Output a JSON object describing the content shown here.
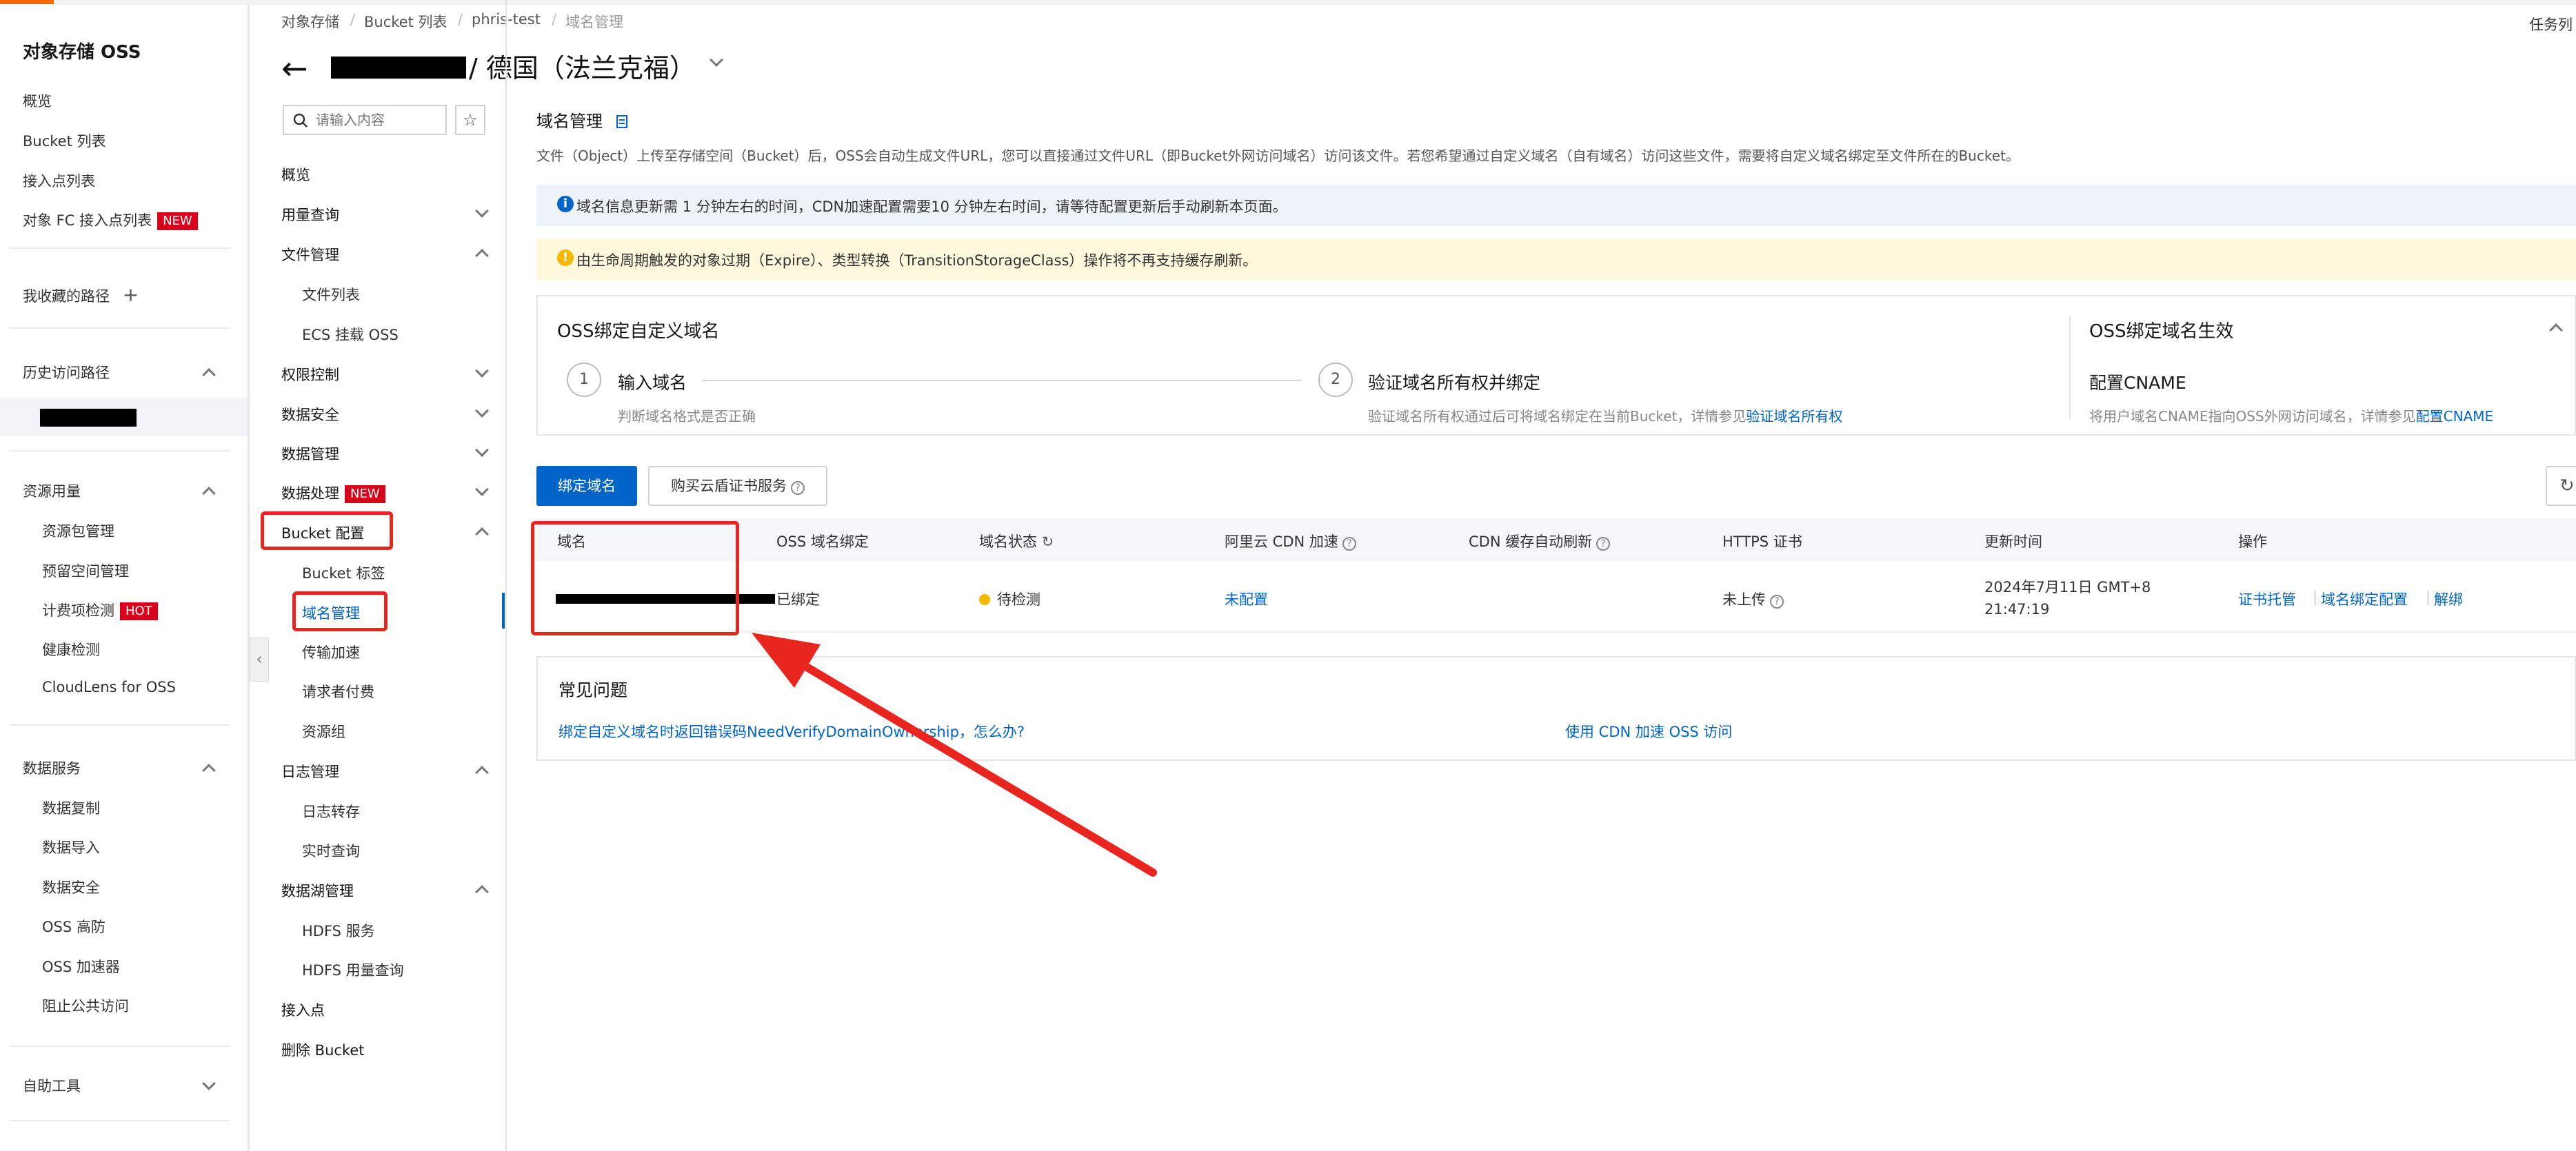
{
  "topbar": {
    "accent_color": "#ff6a00",
    "right_label": "任务列"
  },
  "left_nav": {
    "title": "对象存储 OSS",
    "items": [
      {
        "label": "概览"
      },
      {
        "label": "Bucket 列表"
      },
      {
        "label": "接入点列表"
      },
      {
        "label": "对象 FC 接入点列表",
        "badge": "NEW"
      }
    ],
    "favorites": {
      "label": "我收藏的路径",
      "add_icon": "+"
    },
    "history": {
      "label": "历史访问路径"
    },
    "resource_usage": {
      "label": "资源用量",
      "items": [
        {
          "label": "资源包管理"
        },
        {
          "label": "预留空间管理"
        },
        {
          "label": "计费项检测",
          "badge": "HOT"
        },
        {
          "label": "健康检测"
        },
        {
          "label": "CloudLens for OSS"
        }
      ]
    },
    "data_services": {
      "label": "数据服务",
      "items": [
        {
          "label": "数据复制"
        },
        {
          "label": "数据导入"
        },
        {
          "label": "数据安全"
        },
        {
          "label": "OSS 高防"
        },
        {
          "label": "OSS 加速器"
        },
        {
          "label": "阻止公共访问"
        }
      ]
    },
    "self_tools": {
      "label": "自助工具"
    }
  },
  "breadcrumb": [
    "对象存储",
    "Bucket 列表",
    "phris-test",
    "域名管理"
  ],
  "header": {
    "back_icon": "←",
    "title": "/ 德国（法兰克福）"
  },
  "bucket_nav": {
    "search_placeholder": "请输入内容",
    "items": {
      "overview": "概览",
      "usage": "用量查询",
      "file_mgmt": "文件管理",
      "file_list": "文件列表",
      "ecs_mount": "ECS 挂载 OSS",
      "perm": "权限控制",
      "data_sec": "数据安全",
      "data_mgmt": "数据管理",
      "data_proc": "数据处理",
      "data_proc_badge": "NEW",
      "bucket_cfg": "Bucket 配置",
      "bucket_tag": "Bucket 标签",
      "domain_mgmt": "域名管理",
      "transfer_acc": "传输加速",
      "requester_pays": "请求者付费",
      "resource_group": "资源组",
      "log_mgmt": "日志管理",
      "log_dump": "日志转存",
      "realtime_query": "实时查询",
      "datalake": "数据湖管理",
      "hdfs": "HDFS 服务",
      "hdfs_usage": "HDFS 用量查询",
      "access_point": "接入点",
      "delete_bucket": "删除 Bucket"
    }
  },
  "main": {
    "title": "域名管理",
    "description": "文件（Object）上传至存储空间（Bucket）后，OSS会自动生成文件URL，您可以直接通过文件URL（即Bucket外网访问域名）访问该文件。若您希望通过自定义域名（自有域名）访问这些文件，需要将自定义域名绑定至文件所在的Bucket。",
    "info_notice": "域名信息更新需 1 分钟左右的时间，CDN加速配置需要10 分钟左右时间，请等待配置更新后手动刷新本页面。",
    "warn_notice": "由生命周期触发的对象过期（Expire）、类型转换（TransitionStorageClass）操作将不再支持缓存刷新。",
    "bind_card": {
      "title": "OSS绑定自定义域名",
      "step1": {
        "num": "1",
        "label": "输入域名",
        "desc": "判断域名格式是否正确"
      },
      "step2": {
        "num": "2",
        "label": "验证域名所有权并绑定",
        "desc": "验证域名所有权通过后可将域名绑定在当前Bucket，详情参见",
        "link": "验证域名所有权"
      },
      "right_title": "OSS绑定域名生效",
      "right_step_label": "配置CNAME",
      "right_desc": "将用户域名CNAME指向OSS外网访问域名，详情参见",
      "right_link": "配置CNAME"
    },
    "buttons": {
      "bind": "绑定域名",
      "buy_cert": "购买云盾证书服务"
    },
    "table": {
      "headers": [
        "域名",
        "OSS 域名绑定",
        "域名状态",
        "阿里云 CDN 加速",
        "CDN 缓存自动刷新",
        "HTTPS 证书",
        "更新时间",
        "操作"
      ],
      "rows": [
        {
          "domain": "",
          "binding": "已绑定",
          "status": "待检测",
          "cdn": "未配置",
          "https": "未上传",
          "updated_date": "2024年7月11日 GMT+8",
          "updated_time": "21:47:19",
          "actions": [
            "证书托管",
            "域名绑定配置",
            "解绑"
          ]
        }
      ]
    },
    "faq": {
      "title": "常见问题",
      "links": [
        "绑定自定义域名时返回错误码NeedVerifyDomainOwnership，怎么办?",
        "使用 CDN 加速 OSS 访问"
      ]
    }
  },
  "colors": {
    "primary": "#0064c8",
    "annotation_red": "#e8251f",
    "badge_red": "#d9001b"
  }
}
